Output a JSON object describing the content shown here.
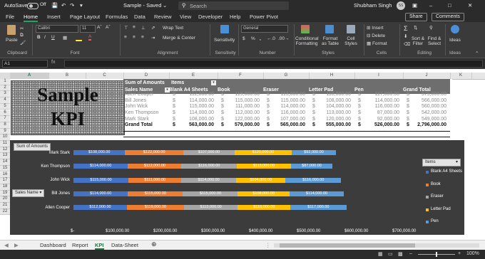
{
  "titlebar": {
    "autosave": "AutoSave",
    "autosave_state": "Off",
    "doc": "Sample - Saved",
    "search": "Search",
    "user": "Shubham Singh",
    "user_initials": "SS"
  },
  "tabs": [
    "File",
    "Home",
    "Insert",
    "Page Layout",
    "Formulas",
    "Data",
    "Review",
    "View",
    "Developer",
    "Help",
    "Power Pivot"
  ],
  "share": "Share",
  "comments": "Comments",
  "ribbon": {
    "paste": "Paste",
    "font_name": "Calibri",
    "font_size": "11",
    "wrap_text": "Wrap Text",
    "merge_center": "Merge & Center",
    "sensitivity": "Sensitivity",
    "number_format": "General",
    "cond_format": "Conditional Formatting",
    "format_table": "Format as Table",
    "cell_styles": "Cell Styles",
    "insert": "Insert",
    "delete": "Delete",
    "format": "Format",
    "sort_filter": "Sort & Filter",
    "find_select": "Find & Select",
    "ideas": "Ideas",
    "groups": [
      "Clipboard",
      "Font",
      "Alignment",
      "Sensitivity",
      "Number",
      "Styles",
      "Cells",
      "Editing",
      "Ideas"
    ]
  },
  "formula_bar": {
    "name_box": "A1",
    "fx": "fx"
  },
  "columns": [
    "A",
    "B",
    "C",
    "D",
    "E",
    "F",
    "G",
    "H",
    "I",
    "J",
    "K"
  ],
  "rows": [
    "1",
    "2",
    "3",
    "4",
    "5",
    "6",
    "7",
    "8",
    "9",
    "10",
    "11",
    "12",
    "13",
    "14",
    "15",
    "16",
    "17",
    "18",
    "19",
    "20",
    "21",
    "22"
  ],
  "kpi_image": {
    "line1": "Sample",
    "line2": "KPI"
  },
  "pivot": {
    "sum_label": "Sum of Amounts",
    "items_label": "Items",
    "row_label": "Sales Name",
    "col_headers": [
      "Blank A4 Sheets",
      "Book",
      "Eraser",
      "Letter Pad",
      "Pen",
      "Grand Total"
    ],
    "rows": [
      {
        "name": "Allen Cooper",
        "values": [
          "112,000.00",
          "119,000.00",
          "113,000.00",
          "110,000.00",
          "117,000.00",
          "579,000.00"
        ]
      },
      {
        "name": "Bill Jones",
        "values": [
          "114,000.00",
          "115,000.00",
          "115,000.00",
          "108,000.00",
          "114,000.00",
          "566,000.00"
        ]
      },
      {
        "name": "John Wick",
        "values": [
          "115,000.00",
          "111,000.00",
          "114,000.00",
          "104,000.00",
          "116,000.00",
          "560,000.00"
        ]
      },
      {
        "name": "Ken Thompson",
        "values": [
          "114,000.00",
          "112,000.00",
          "116,000.00",
          "113,000.00",
          "87,000.00",
          "542,000.00"
        ]
      },
      {
        "name": "Mark Stark",
        "values": [
          "108,000.00",
          "122,000.00",
          "107,000.00",
          "120,000.00",
          "92,000.00",
          "549,000.00"
        ]
      }
    ],
    "grand_total_label": "Grand Total",
    "grand_totals": [
      "563,000.00",
      "579,000.00",
      "565,000.00",
      "555,000.00",
      "526,000.00",
      "2,796,000.00"
    ],
    "currency": "$"
  },
  "chart_data": {
    "type": "bar",
    "orientation": "horizontal",
    "stacked": true,
    "categories": [
      "Mark Stark",
      "Ken Thompson",
      "John Wick",
      "Bill Jones",
      "Allen Cooper"
    ],
    "series": [
      {
        "name": "Blank A4 Sheets",
        "color": "#4472c4",
        "values": [
          108000,
          114000,
          115000,
          114000,
          112000
        ]
      },
      {
        "name": "Book",
        "color": "#ed7d31",
        "values": [
          122000,
          112000,
          111000,
          115000,
          119000
        ]
      },
      {
        "name": "Eraser",
        "color": "#a5a5a5",
        "values": [
          107000,
          116000,
          114000,
          115000,
          113000
        ]
      },
      {
        "name": "Letter Pad",
        "color": "#ffc000",
        "values": [
          120000,
          113000,
          104000,
          108000,
          110000
        ]
      },
      {
        "name": "Pen",
        "color": "#5b9bd5",
        "values": [
          92000,
          87000,
          116000,
          114000,
          117000
        ]
      }
    ],
    "bar_labels": [
      [
        "$108,000.00",
        "$122,000.00",
        "$107,000.00",
        "$120,000.00",
        "$92,000.00"
      ],
      [
        "$114,000.00",
        "$112,000.00",
        "$116,000.00",
        "$113,000.00",
        "$87,000.00"
      ],
      [
        "$115,000.00",
        "$111,000.00",
        "$114,000.00",
        "$104,000.00",
        "$116,000.00"
      ],
      [
        "$114,000.00",
        "$115,000.00",
        "$115,000.00",
        "$108,000.00",
        "$114,000.00"
      ],
      [
        "$112,000.00",
        "$119,000.00",
        "$113,000.00",
        "$110,000.00",
        "$117,000.00"
      ]
    ],
    "xlim": [
      0,
      700000
    ],
    "x_ticks": [
      "$-",
      "$100,000.00",
      "$200,000.00",
      "$300,000.00",
      "$400,000.00",
      "$500,000.00",
      "$600,000.00",
      "$700,000.00"
    ],
    "grid": false,
    "legend_position": "right",
    "field_buttons": {
      "values": "Sum of Amounts",
      "axis": "Sales Name",
      "legend": "Items"
    }
  },
  "sheets": [
    "Dashboard",
    "Report",
    "KPI",
    "Data-Sheet"
  ],
  "active_sheet": "KPI",
  "status": {
    "zoom": "100%"
  }
}
